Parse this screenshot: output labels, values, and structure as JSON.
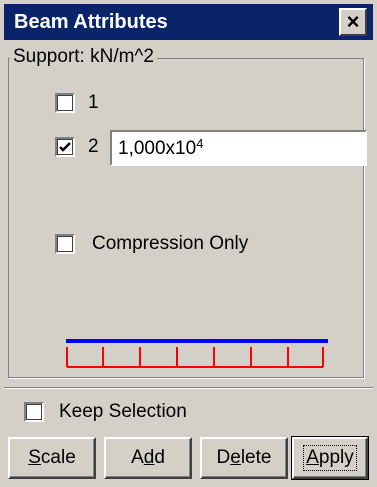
{
  "window": {
    "title": "Beam Attributes",
    "close_glyph": "×"
  },
  "support_group": {
    "title": "Support: kN/m^2",
    "option1": {
      "label": "1",
      "checked": false
    },
    "option2": {
      "label": "2",
      "checked": true,
      "value_base": "1,000x10",
      "value_exp": "4"
    },
    "compression_only": {
      "label": "Compression Only",
      "checked": false
    }
  },
  "diagram": {
    "beam_color": "#0000ff",
    "support_color": "#ff0000"
  },
  "keep_selection": {
    "label": "Keep Selection",
    "checked": false
  },
  "buttons": {
    "scale": {
      "mnemonic": "S",
      "rest": "cale"
    },
    "add": {
      "pre": "A",
      "mnemonic": "d",
      "rest": "d"
    },
    "delete": {
      "pre": "D",
      "mnemonic": "e",
      "rest": "lete"
    },
    "apply": {
      "mnemonic": "A",
      "rest": "pply"
    }
  }
}
